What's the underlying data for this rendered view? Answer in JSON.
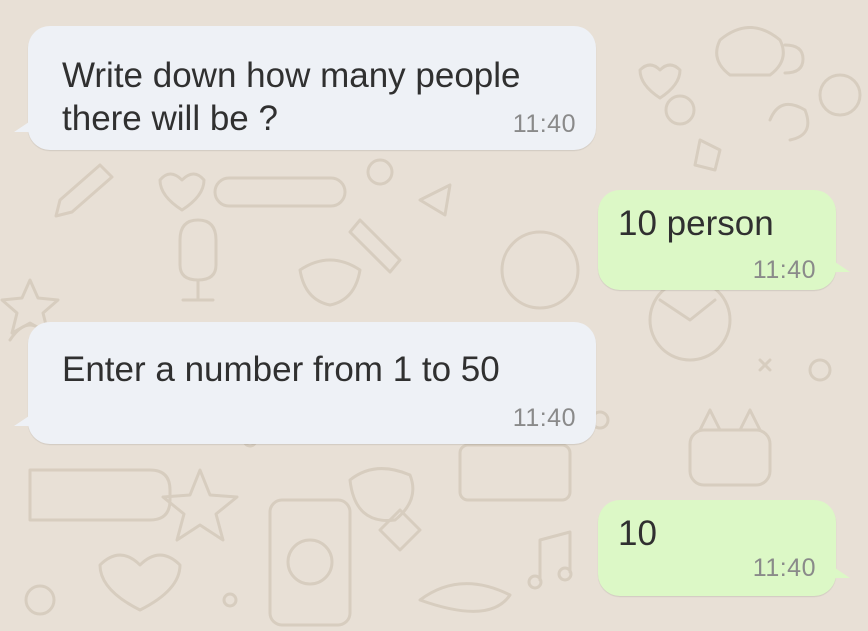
{
  "chat": {
    "messages": [
      {
        "direction": "incoming",
        "text": "Write down how many people\nthere will be ?",
        "time": "11:40"
      },
      {
        "direction": "outgoing",
        "text": "10 person",
        "time": "11:40"
      },
      {
        "direction": "incoming",
        "text": "Enter a number from 1 to 50",
        "time": "11:40"
      },
      {
        "direction": "outgoing",
        "text": "10",
        "time": "11:40"
      }
    ]
  },
  "colors": {
    "wallpaper": "#e8e0d6",
    "incoming_bubble": "#eef1f6",
    "outgoing_bubble": "#dcf8c6",
    "text": "#303030",
    "timestamp": "#8a8a8a"
  }
}
